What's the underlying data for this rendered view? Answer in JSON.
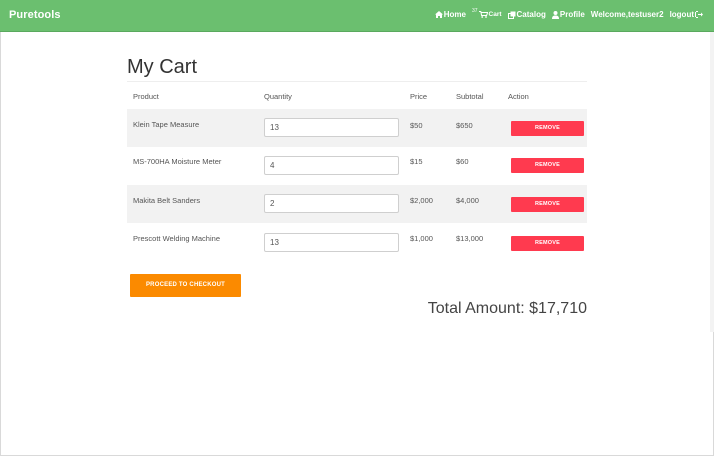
{
  "navbar": {
    "brand": "Puretools",
    "cart_count": "37",
    "items": [
      {
        "label": "Home",
        "icon": "home-icon"
      },
      {
        "label": "Cart",
        "icon": "cart-icon"
      },
      {
        "label": "Catalog",
        "icon": "catalog-icon"
      },
      {
        "label": "Profile",
        "icon": "user-icon"
      },
      {
        "label": "Welcome,testuser2",
        "icon": ""
      },
      {
        "label": "logout",
        "icon": "logout-icon"
      }
    ]
  },
  "page": {
    "title": "My Cart",
    "columns": [
      "Product",
      "Quantity",
      "Price",
      "Subtotal",
      "Action"
    ],
    "rows": [
      {
        "product": "Klein Tape Measure",
        "quantity": "13",
        "price": "$50",
        "subtotal": "$650",
        "action": "REMOVE"
      },
      {
        "product": "MS-700HA Moisture Meter",
        "quantity": "4",
        "price": "$15",
        "subtotal": "$60",
        "action": "REMOVE"
      },
      {
        "product": "Makita Belt Sanders",
        "quantity": "2",
        "price": "$2,000",
        "subtotal": "$4,000",
        "action": "REMOVE"
      },
      {
        "product": "Prescott Welding Machine",
        "quantity": "13",
        "price": "$1,000",
        "subtotal": "$13,000",
        "action": "REMOVE"
      }
    ],
    "checkout_label": "PROCEED TO CHECKOUT",
    "total": "Total Amount: $17,710"
  },
  "colors": {
    "navbar": "#6bbf6f",
    "remove_button": "#ff3a4f",
    "checkout_button": "#fb8a00"
  }
}
